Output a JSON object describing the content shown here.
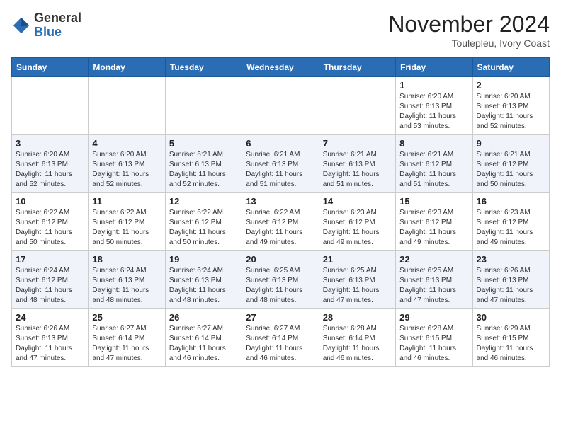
{
  "header": {
    "logo_general": "General",
    "logo_blue": "Blue",
    "month_year": "November 2024",
    "location": "Toulepleu, Ivory Coast"
  },
  "weekdays": [
    "Sunday",
    "Monday",
    "Tuesday",
    "Wednesday",
    "Thursday",
    "Friday",
    "Saturday"
  ],
  "weeks": [
    [
      {
        "day": "",
        "info": ""
      },
      {
        "day": "",
        "info": ""
      },
      {
        "day": "",
        "info": ""
      },
      {
        "day": "",
        "info": ""
      },
      {
        "day": "",
        "info": ""
      },
      {
        "day": "1",
        "info": "Sunrise: 6:20 AM\nSunset: 6:13 PM\nDaylight: 11 hours and 53 minutes."
      },
      {
        "day": "2",
        "info": "Sunrise: 6:20 AM\nSunset: 6:13 PM\nDaylight: 11 hours and 52 minutes."
      }
    ],
    [
      {
        "day": "3",
        "info": "Sunrise: 6:20 AM\nSunset: 6:13 PM\nDaylight: 11 hours and 52 minutes."
      },
      {
        "day": "4",
        "info": "Sunrise: 6:20 AM\nSunset: 6:13 PM\nDaylight: 11 hours and 52 minutes."
      },
      {
        "day": "5",
        "info": "Sunrise: 6:21 AM\nSunset: 6:13 PM\nDaylight: 11 hours and 52 minutes."
      },
      {
        "day": "6",
        "info": "Sunrise: 6:21 AM\nSunset: 6:13 PM\nDaylight: 11 hours and 51 minutes."
      },
      {
        "day": "7",
        "info": "Sunrise: 6:21 AM\nSunset: 6:13 PM\nDaylight: 11 hours and 51 minutes."
      },
      {
        "day": "8",
        "info": "Sunrise: 6:21 AM\nSunset: 6:12 PM\nDaylight: 11 hours and 51 minutes."
      },
      {
        "day": "9",
        "info": "Sunrise: 6:21 AM\nSunset: 6:12 PM\nDaylight: 11 hours and 50 minutes."
      }
    ],
    [
      {
        "day": "10",
        "info": "Sunrise: 6:22 AM\nSunset: 6:12 PM\nDaylight: 11 hours and 50 minutes."
      },
      {
        "day": "11",
        "info": "Sunrise: 6:22 AM\nSunset: 6:12 PM\nDaylight: 11 hours and 50 minutes."
      },
      {
        "day": "12",
        "info": "Sunrise: 6:22 AM\nSunset: 6:12 PM\nDaylight: 11 hours and 50 minutes."
      },
      {
        "day": "13",
        "info": "Sunrise: 6:22 AM\nSunset: 6:12 PM\nDaylight: 11 hours and 49 minutes."
      },
      {
        "day": "14",
        "info": "Sunrise: 6:23 AM\nSunset: 6:12 PM\nDaylight: 11 hours and 49 minutes."
      },
      {
        "day": "15",
        "info": "Sunrise: 6:23 AM\nSunset: 6:12 PM\nDaylight: 11 hours and 49 minutes."
      },
      {
        "day": "16",
        "info": "Sunrise: 6:23 AM\nSunset: 6:12 PM\nDaylight: 11 hours and 49 minutes."
      }
    ],
    [
      {
        "day": "17",
        "info": "Sunrise: 6:24 AM\nSunset: 6:12 PM\nDaylight: 11 hours and 48 minutes."
      },
      {
        "day": "18",
        "info": "Sunrise: 6:24 AM\nSunset: 6:13 PM\nDaylight: 11 hours and 48 minutes."
      },
      {
        "day": "19",
        "info": "Sunrise: 6:24 AM\nSunset: 6:13 PM\nDaylight: 11 hours and 48 minutes."
      },
      {
        "day": "20",
        "info": "Sunrise: 6:25 AM\nSunset: 6:13 PM\nDaylight: 11 hours and 48 minutes."
      },
      {
        "day": "21",
        "info": "Sunrise: 6:25 AM\nSunset: 6:13 PM\nDaylight: 11 hours and 47 minutes."
      },
      {
        "day": "22",
        "info": "Sunrise: 6:25 AM\nSunset: 6:13 PM\nDaylight: 11 hours and 47 minutes."
      },
      {
        "day": "23",
        "info": "Sunrise: 6:26 AM\nSunset: 6:13 PM\nDaylight: 11 hours and 47 minutes."
      }
    ],
    [
      {
        "day": "24",
        "info": "Sunrise: 6:26 AM\nSunset: 6:13 PM\nDaylight: 11 hours and 47 minutes."
      },
      {
        "day": "25",
        "info": "Sunrise: 6:27 AM\nSunset: 6:14 PM\nDaylight: 11 hours and 47 minutes."
      },
      {
        "day": "26",
        "info": "Sunrise: 6:27 AM\nSunset: 6:14 PM\nDaylight: 11 hours and 46 minutes."
      },
      {
        "day": "27",
        "info": "Sunrise: 6:27 AM\nSunset: 6:14 PM\nDaylight: 11 hours and 46 minutes."
      },
      {
        "day": "28",
        "info": "Sunrise: 6:28 AM\nSunset: 6:14 PM\nDaylight: 11 hours and 46 minutes."
      },
      {
        "day": "29",
        "info": "Sunrise: 6:28 AM\nSunset: 6:15 PM\nDaylight: 11 hours and 46 minutes."
      },
      {
        "day": "30",
        "info": "Sunrise: 6:29 AM\nSunset: 6:15 PM\nDaylight: 11 hours and 46 minutes."
      }
    ]
  ]
}
